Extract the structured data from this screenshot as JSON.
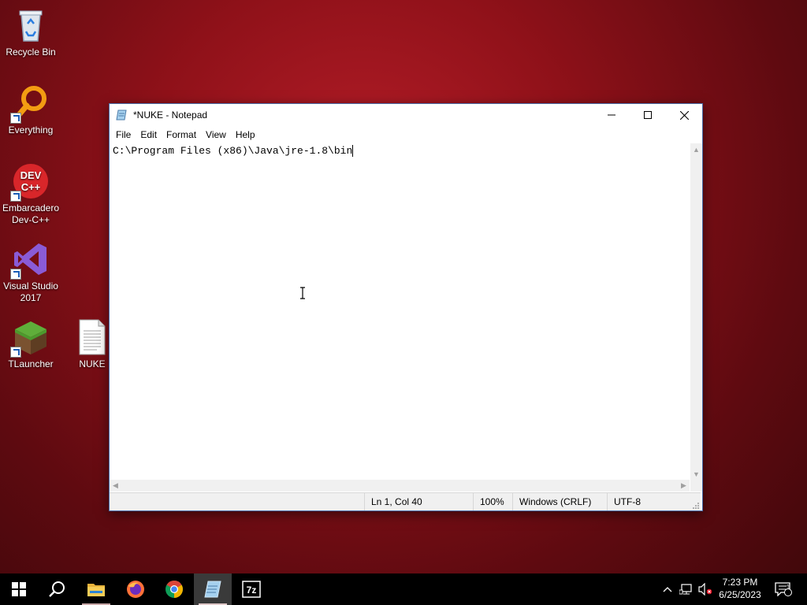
{
  "desktop": {
    "icons": [
      {
        "label": "Recycle Bin"
      },
      {
        "label": "Everything"
      },
      {
        "label": "Embarcadero Dev-C++"
      },
      {
        "label": "Visual Studio 2017"
      },
      {
        "label": "TLauncher"
      },
      {
        "label": "NUKE"
      }
    ],
    "devcpp_logo_text": "DEV C++"
  },
  "notepad": {
    "title": "*NUKE - Notepad",
    "menu": [
      "File",
      "Edit",
      "Format",
      "View",
      "Help"
    ],
    "content": "C:\\Program Files (x86)\\Java\\jre-1.8\\bin",
    "status": {
      "position": "Ln 1, Col 40",
      "zoom": "100%",
      "line_ending": "Windows (CRLF)",
      "encoding": "UTF-8"
    }
  },
  "taskbar": {
    "apps": [
      "start-icon",
      "search-icon",
      "file-explorer-icon",
      "firefox-icon",
      "chrome-icon",
      "notepad-icon",
      "7zip-icon"
    ],
    "sevenzip_label": "7z",
    "active_app": "notepad-icon",
    "clock": {
      "time": "7:23 PM",
      "date": "6/25/2023"
    },
    "notification_count": "1"
  },
  "colors": {
    "accent": "#0078d7",
    "taskbar": "#000000",
    "desktop": "#8f1119"
  }
}
